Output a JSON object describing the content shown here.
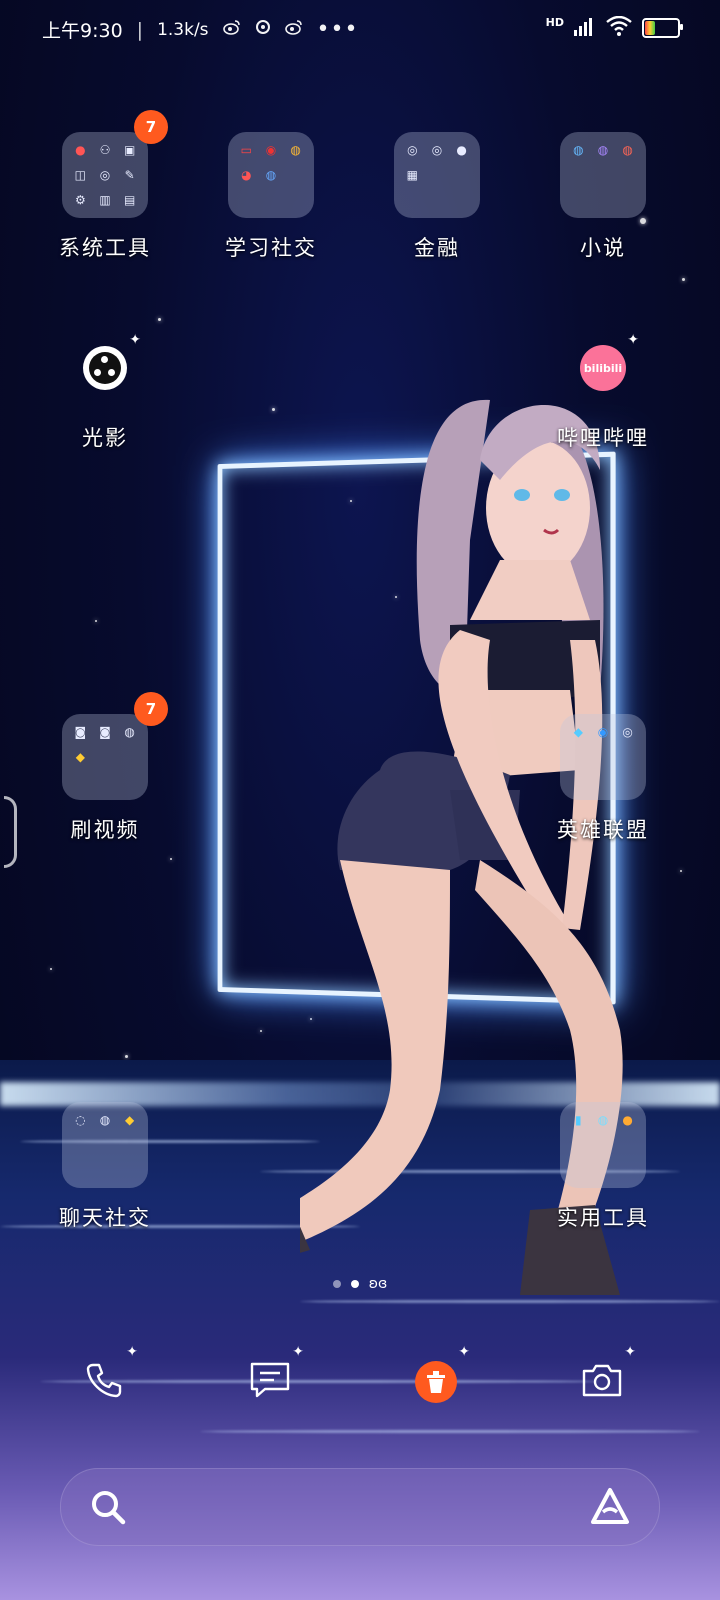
{
  "status_bar": {
    "time": "上午9:30",
    "network_speed": "1.3k/s",
    "notification_icons": [
      "weibo-icon",
      "app-icon",
      "weibo-icon"
    ],
    "more_icon": "more-icon",
    "hd_label": "HD",
    "battery_level": 0.3
  },
  "home_apps": [
    {
      "label": "系统工具",
      "badge": "7",
      "type": "folder"
    },
    {
      "label": "学习社交",
      "type": "folder"
    },
    {
      "label": "金融",
      "type": "folder"
    },
    {
      "label": "小说",
      "type": "folder"
    },
    {
      "label": "光影",
      "type": "app"
    },
    {
      "label": "哔哩哔哩",
      "type": "app",
      "logo_text": "bilibili"
    },
    {
      "label": "刷视频",
      "badge": "7",
      "type": "folder"
    },
    {
      "label": "英雄联盟",
      "type": "folder"
    },
    {
      "label": "聊天社交",
      "type": "folder"
    },
    {
      "label": "实用工具",
      "type": "folder"
    }
  ],
  "dock": {
    "items": [
      "phone-icon",
      "messages-icon",
      "delete-icon",
      "camera-icon"
    ]
  },
  "search_bar": {
    "left_icon": "search-icon",
    "right_icon": "assistant-icon"
  },
  "colors": {
    "badge": "#ff5a1f",
    "accent_orange": "#ff5a1f",
    "bilibili_pink": "#fb7299"
  }
}
